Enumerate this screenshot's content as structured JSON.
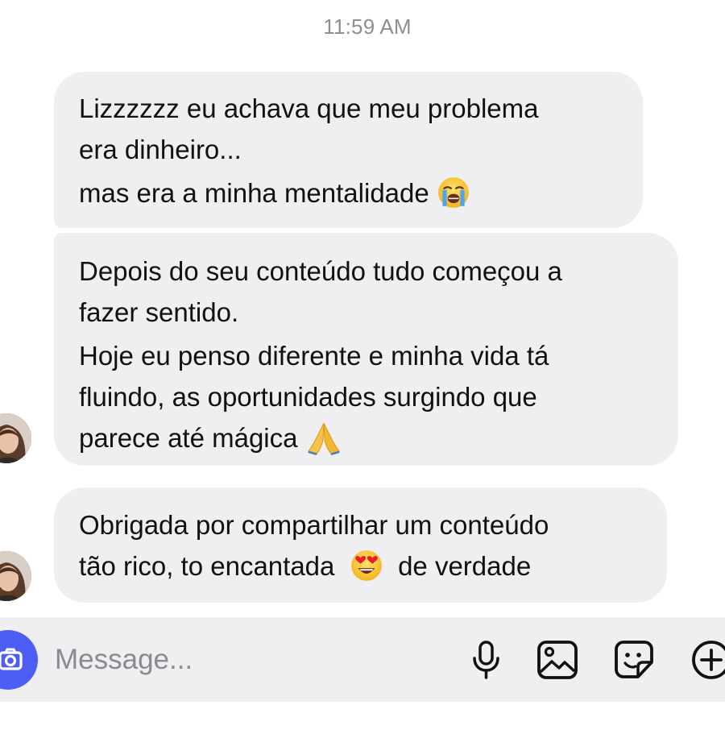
{
  "chat": {
    "timestamp": "11:59 AM",
    "messages": [
      {
        "lines": [
          "Lizzzzzz eu achava que meu problema",
          "era dinheiro...",
          "mas era a minha mentalidade"
        ],
        "emoji": "loudly-crying-face"
      },
      {
        "lines": [
          "Depois do seu conteúdo tudo começou a",
          "fazer sentido.",
          "Hoje eu penso diferente e minha vida tá",
          "fluindo, as oportunidades surgindo que",
          "parece até mágica"
        ],
        "emoji": "folded-hands"
      },
      {
        "lines": [
          "Obrigada por compartilhar um conteúdo",
          "tão rico, to encantada",
          "de verdade"
        ],
        "emoji": "smiling-face-with-heart-eyes"
      }
    ]
  },
  "composer": {
    "placeholder": "Message...",
    "icons": [
      "camera-icon",
      "microphone-icon",
      "gallery-icon",
      "sticker-icon",
      "plus-icon"
    ],
    "accent_color": "#4d5ef6"
  },
  "colors": {
    "bubble_background": "#efeff1",
    "timestamp_text": "#8e8e93"
  }
}
